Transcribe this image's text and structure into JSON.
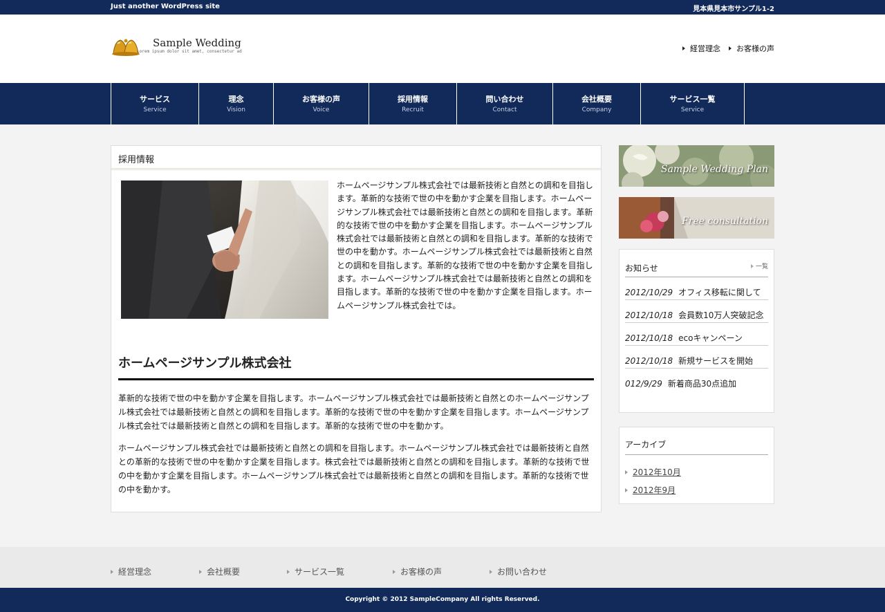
{
  "topbar": {
    "tagline": "Just another WordPress site",
    "address": "見本県見本市サンプル1-2"
  },
  "header": {
    "logo_icon": "wedding-bells-icon",
    "logo_title": "Sample Wedding",
    "logo_subtitle": "Lorem ipsum dolor sit amet, consectetur ad",
    "links": [
      "経営理念",
      "お客様の声"
    ]
  },
  "nav": [
    {
      "jp": "サービス",
      "en": "Service"
    },
    {
      "jp": "理念",
      "en": "Vision"
    },
    {
      "jp": "お客様の声",
      "en": "Voice"
    },
    {
      "jp": "採用情報",
      "en": "Recruit"
    },
    {
      "jp": "問い合わせ",
      "en": "Contact"
    },
    {
      "jp": "会社概要",
      "en": "Company"
    },
    {
      "jp": "サービス一覧",
      "en": "Service"
    }
  ],
  "main": {
    "heading": "採用情報",
    "intro": "ホームページサンプル株式会社では最新技術と自然との調和を目指します。革新的な技術で世の中を動かす企業を目指します。ホームページサンプル株式会社では最新技術と自然との調和を目指します。革新的な技術で世の中を動かす企業を目指します。ホームページサンプル株式会社では最新技術と自然との調和を目指します。革新的な技術で世の中を動かす。ホームページサンプル株式会社では最新技術と自然との調和を目指します。革新的な技術で世の中を動かす企業を目指します。ホームページサンプル株式会社では最新技術と自然との調和を目指します。革新的な技術で世の中を動かす企業を目指します。ホームページサンプル株式会社では。",
    "company_title": "ホームページサンプル株式会社",
    "paragraph1": "革新的な技術で世の中を動かす企業を目指します。ホームページサンプル株式会社では最新技術と自然とのホームページサンプル株式会社では最新技術と自然との調和を目指します。革新的な技術で世の中を動かす企業を目指します。ホームページサンプル株式会社では最新技術と自然との調和を目指します。革新的な技術で世の中を動かす。",
    "paragraph2": "ホームページサンプル株式会社では最新技術と自然との調和を目指します。ホームページサンプル株式会社では最新技術と自然との革新的な技術で世の中を動かす企業を目指します。株式会社では最新技術と自然との調和を目指します。革新的な技術で世の中を動かす企業を目指します。ホームページサンプル株式会社では最新技術と自然との調和を目指します。革新的な技術で世の中を動かす。"
  },
  "sidebar": {
    "banner1": "Sample Wedding Plan",
    "banner2": "Free consultation",
    "news": {
      "title": "お知らせ",
      "more": "一覧",
      "items": [
        {
          "date": "2012/10/29",
          "text": "オフィス移転に関して"
        },
        {
          "date": "2012/10/18",
          "text": "会員数10万人突破記念"
        },
        {
          "date": "2012/10/18",
          "text": "ecoキャンペーン"
        },
        {
          "date": "2012/10/18",
          "text": "新規サービスを開始"
        },
        {
          "date": "012/9/29",
          "text": "新着商品30点追加"
        }
      ]
    },
    "archive": {
      "title": "アーカイブ",
      "items": [
        "2012年10月",
        "2012年9月"
      ]
    }
  },
  "footer": {
    "links": [
      "経営理念",
      "会社概要",
      "サービス一覧",
      "お客様の声",
      "お問い合わせ"
    ],
    "copyright": "Copyright © 2012 SampleCompany All rights Reserved."
  },
  "colors": {
    "navy": "#112a5a",
    "background": "#f3f3f3"
  }
}
